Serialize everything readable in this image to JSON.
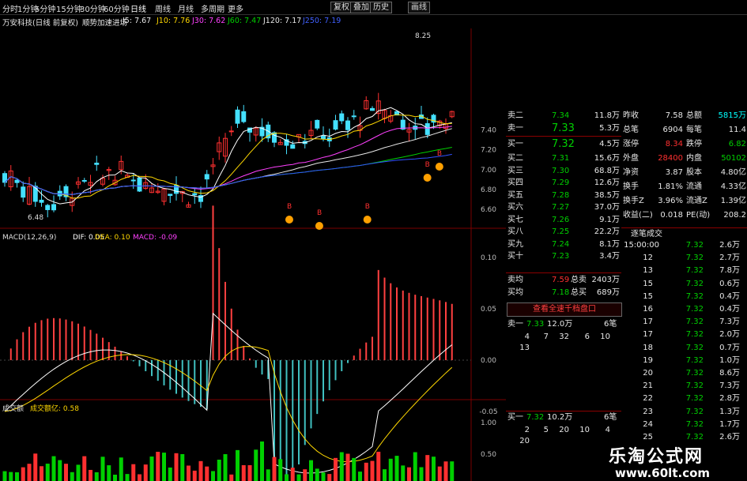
{
  "toolbar": {
    "periods": [
      "分时",
      "1分钟",
      "5分钟",
      "15分钟",
      "30分钟",
      "60分钟",
      "日线",
      "周线",
      "月线",
      "多周期",
      "更多"
    ],
    "selected": "日线",
    "right_buttons": [
      "复权",
      "叠加",
      "历史",
      "画线"
    ]
  },
  "info": {
    "stock": "万安科技(日线 前复权)",
    "indicator": "顺势加速进场",
    "j5": "J5: 7.67",
    "j10": "J10: 7.76",
    "j30": "J30: 7.62",
    "j60": "J60: 7.47",
    "j120": "J120: 7.17",
    "j250": "J250: 7.19",
    "high_label": "8.25",
    "low_label": "6.48"
  },
  "axis_main": [
    "7.40",
    "7.20",
    "7.00",
    "6.80",
    "6.60"
  ],
  "macd": {
    "label": "MACD(12,26,9)",
    "dif": "DIF: 0.05",
    "dea": "DEA: 0.10",
    "macd": "MACD: -0.09",
    "axis": [
      "0.10",
      "0.05",
      "0.00",
      "-0.05"
    ]
  },
  "volume": {
    "label": "成交额",
    "sub": "成交额亿: 0.58",
    "axis": [
      "1.00",
      "0.50"
    ]
  },
  "order_book": {
    "asks": [
      {
        "label": "卖二",
        "price": "7.34",
        "vol": "11.8万"
      },
      {
        "label": "卖一",
        "price": "7.33",
        "vol": "5.3万"
      }
    ],
    "bids": [
      {
        "label": "买一",
        "price": "7.32",
        "vol": "4.5万"
      },
      {
        "label": "买二",
        "price": "7.31",
        "vol": "15.6万"
      },
      {
        "label": "买三",
        "price": "7.30",
        "vol": "68.8万"
      },
      {
        "label": "买四",
        "price": "7.29",
        "vol": "12.6万"
      },
      {
        "label": "买五",
        "price": "7.28",
        "vol": "38.5万"
      },
      {
        "label": "买六",
        "price": "7.27",
        "vol": "37.0万"
      },
      {
        "label": "买七",
        "price": "7.26",
        "vol": "9.1万"
      },
      {
        "label": "买八",
        "price": "7.25",
        "vol": "22.2万"
      },
      {
        "label": "买九",
        "price": "7.24",
        "vol": "8.1万"
      },
      {
        "label": "买十",
        "price": "7.23",
        "vol": "3.4万"
      }
    ],
    "avg_sell": {
      "label": "卖均",
      "price": "7.59",
      "t_label": "总卖",
      "t_val": "2403万"
    },
    "avg_buy": {
      "label": "买均",
      "price": "7.18",
      "t_label": "总买",
      "t_val": "689万"
    },
    "button": "查看全速千档盘口",
    "sell1": {
      "label": "卖一",
      "price": "7.33",
      "vol": "12.0万",
      "count": "6笔",
      "orders": [
        "4",
        "7",
        "32",
        "6",
        "10",
        "13"
      ]
    },
    "buy1": {
      "label": "买一",
      "price": "7.32",
      "vol": "10.2万",
      "count": "6笔",
      "orders": [
        "2",
        "5",
        "20",
        "10",
        "4",
        "20"
      ]
    }
  },
  "stats": [
    {
      "l1": "昨收",
      "v1": "7.58",
      "l2": "总额",
      "v2": "5815万"
    },
    {
      "l1": "总笔",
      "v1": "6904",
      "l2": "每笔",
      "v2": "11.4"
    },
    {
      "l1": "涨停",
      "v1": "8.34",
      "l2": "跌停",
      "v2": "6.82"
    },
    {
      "l1": "外盘",
      "v1": "28400",
      "l2": "内盘",
      "v2": "50102"
    },
    {
      "l1": "净资",
      "v1": "3.87",
      "l2": "股本",
      "v2": "4.80亿"
    },
    {
      "l1": "换手",
      "v1": "1.81%",
      "l2": "流通",
      "v2": "4.33亿"
    },
    {
      "l1": "换手Z",
      "v1": "3.96%",
      "l2": "流通Z",
      "v2": "1.39亿"
    },
    {
      "l1": "收益(二)",
      "v1": "0.018",
      "l2": "PE(动)",
      "v2": "208.2"
    }
  ],
  "ticks": {
    "title": "逐笔成交",
    "rows": [
      {
        "t": "15:00:00",
        "p": "7.32",
        "v": "2.6万"
      },
      {
        "t": "12",
        "p": "7.32",
        "v": "2.7万"
      },
      {
        "t": "13",
        "p": "7.32",
        "v": "7.8万"
      },
      {
        "t": "15",
        "p": "7.32",
        "v": "0.6万"
      },
      {
        "t": "15",
        "p": "7.32",
        "v": "0.4万"
      },
      {
        "t": "16",
        "p": "7.32",
        "v": "0.4万"
      },
      {
        "t": "17",
        "p": "7.32",
        "v": "7.3万"
      },
      {
        "t": "17",
        "p": "7.32",
        "v": "2.0万"
      },
      {
        "t": "18",
        "p": "7.32",
        "v": "0.7万"
      },
      {
        "t": "19",
        "p": "7.32",
        "v": "1.0万"
      },
      {
        "t": "20",
        "p": "7.32",
        "v": "8.6万"
      },
      {
        "t": "21",
        "p": "7.32",
        "v": "7.3万"
      },
      {
        "t": "22",
        "p": "7.32",
        "v": "2.8万"
      },
      {
        "t": "23",
        "p": "7.32",
        "v": "1.3万"
      },
      {
        "t": "24",
        "p": "7.32",
        "v": "1.7万"
      },
      {
        "t": "25",
        "p": "7.32",
        "v": "2.6万"
      }
    ]
  },
  "watermark": {
    "title": "乐淘公式网",
    "url": "www.60lt.com"
  }
}
